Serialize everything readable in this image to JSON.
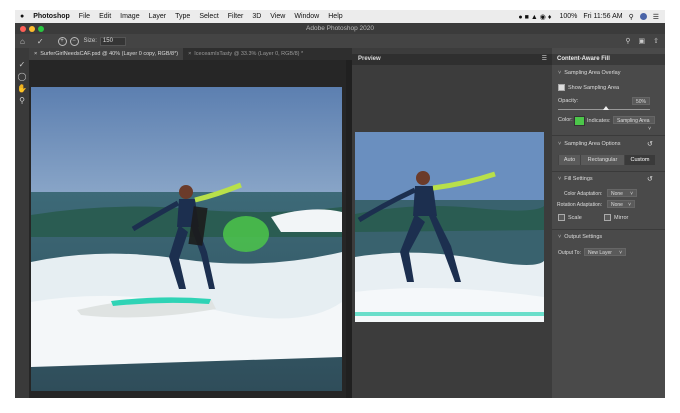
{
  "menu_bar": {
    "apple_icon": "apple-icon",
    "app_name": "Photoshop",
    "items": [
      "File",
      "Edit",
      "Image",
      "Layer",
      "Type",
      "Select",
      "Filter",
      "3D",
      "View",
      "Window",
      "Help"
    ],
    "battery": "100%",
    "clock": "Fri 11:56 AM"
  },
  "window": {
    "title": "Adobe Photoshop 2020"
  },
  "options_bar": {
    "size_label": "Size:",
    "size_value": "150"
  },
  "tabs": [
    {
      "label": "SurferGirlNeedsCAF.psd @ 40% (Layer 0 copy, RGB/8*)",
      "active": true
    },
    {
      "label": "IceceamIsTasty @ 33.3% (Layer 0, RGB/8) *",
      "active": false
    }
  ],
  "preview": {
    "title": "Preview"
  },
  "panel": {
    "title": "Content-Aware Fill",
    "sampling_overlay": {
      "heading": "Sampling Area Overlay",
      "show_label": "Show Sampling Area",
      "show_checked": true,
      "opacity_label": "Opacity:",
      "opacity_value": "50%",
      "color_label": "Color:",
      "color_swatch": "#4cc64a",
      "indicates_label": "Indicates:",
      "indicates_value": "Sampling Area"
    },
    "sampling_options": {
      "heading": "Sampling Area Options",
      "modes": [
        "Auto",
        "Rectangular",
        "Custom"
      ],
      "selected": "Custom"
    },
    "fill_settings": {
      "heading": "Fill Settings",
      "color_adaptation_label": "Color Adaptation:",
      "color_adaptation_value": "None",
      "rotation_adaptation_label": "Rotation Adaptation:",
      "rotation_adaptation_value": "None",
      "scale_label": "Scale",
      "mirror_label": "Mirror"
    },
    "output_settings": {
      "heading": "Output Settings",
      "output_to_label": "Output To:",
      "output_to_value": "New Layer"
    }
  }
}
